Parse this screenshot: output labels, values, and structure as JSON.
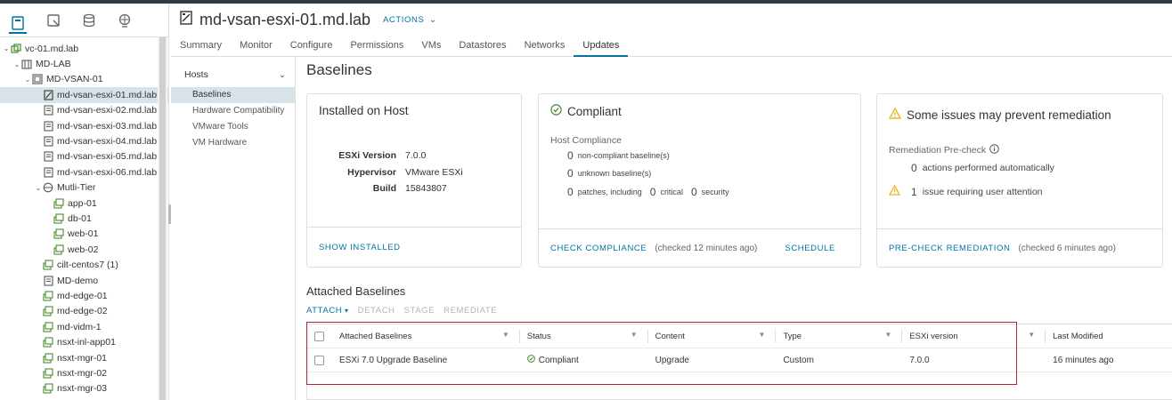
{
  "navigator": {
    "tree": [
      {
        "label": "vc-01.md.lab",
        "indent": 0,
        "chevron": "v",
        "icon": "vcenter"
      },
      {
        "label": "MD-LAB",
        "indent": 1,
        "chevron": "v",
        "icon": "datacenter"
      },
      {
        "label": "MD-VSAN-01",
        "indent": 2,
        "chevron": "v",
        "icon": "cluster"
      },
      {
        "label": "md-vsan-esxi-01.md.lab ...",
        "indent": 3,
        "chevron": "",
        "icon": "host-maint",
        "selected": true
      },
      {
        "label": "md-vsan-esxi-02.md.lab",
        "indent": 3,
        "chevron": "",
        "icon": "host"
      },
      {
        "label": "md-vsan-esxi-03.md.lab",
        "indent": 3,
        "chevron": "",
        "icon": "host"
      },
      {
        "label": "md-vsan-esxi-04.md.lab",
        "indent": 3,
        "chevron": "",
        "icon": "host"
      },
      {
        "label": "md-vsan-esxi-05.md.lab",
        "indent": 3,
        "chevron": "",
        "icon": "host"
      },
      {
        "label": "md-vsan-esxi-06.md.lab",
        "indent": 3,
        "chevron": "",
        "icon": "host"
      },
      {
        "label": "Mutli-Tier",
        "indent": 3,
        "chevron": "v",
        "icon": "vapp"
      },
      {
        "label": "app-01",
        "indent": 4,
        "chevron": "",
        "icon": "vm"
      },
      {
        "label": "db-01",
        "indent": 4,
        "chevron": "",
        "icon": "vm"
      },
      {
        "label": "web-01",
        "indent": 4,
        "chevron": "",
        "icon": "vm"
      },
      {
        "label": "web-02",
        "indent": 4,
        "chevron": "",
        "icon": "vm"
      },
      {
        "label": "cilt-centos7 (1)",
        "indent": 3,
        "chevron": "",
        "icon": "vm"
      },
      {
        "label": "MD-demo",
        "indent": 3,
        "chevron": "",
        "icon": "host"
      },
      {
        "label": "md-edge-01",
        "indent": 3,
        "chevron": "",
        "icon": "vm"
      },
      {
        "label": "md-edge-02",
        "indent": 3,
        "chevron": "",
        "icon": "vm"
      },
      {
        "label": "md-vidm-1",
        "indent": 3,
        "chevron": "",
        "icon": "vm"
      },
      {
        "label": "nsxt-inl-app01",
        "indent": 3,
        "chevron": "",
        "icon": "vm"
      },
      {
        "label": "nsxt-mgr-01",
        "indent": 3,
        "chevron": "",
        "icon": "vm"
      },
      {
        "label": "nsxt-mgr-02",
        "indent": 3,
        "chevron": "",
        "icon": "vm"
      },
      {
        "label": "nsxt-mgr-03",
        "indent": 3,
        "chevron": "",
        "icon": "vm"
      }
    ]
  },
  "header": {
    "title": "md-vsan-esxi-01.md.lab",
    "actions_label": "ACTIONS",
    "tabs": [
      "Summary",
      "Monitor",
      "Configure",
      "Permissions",
      "VMs",
      "Datastores",
      "Networks",
      "Updates"
    ],
    "active_tab": "Updates"
  },
  "subnav": {
    "group": "Hosts",
    "items": [
      "Baselines",
      "Hardware Compatibility",
      "VMware Tools",
      "VM Hardware"
    ]
  },
  "main": {
    "title": "Baselines",
    "installed": {
      "title": "Installed on Host",
      "rows": [
        {
          "k": "ESXi Version",
          "v": "7.0.0"
        },
        {
          "k": "Hypervisor",
          "v": "VMware ESXi"
        },
        {
          "k": "Build",
          "v": "15843807"
        }
      ],
      "action": "SHOW INSTALLED"
    },
    "compliant": {
      "title": "Compliant",
      "subtitle": "Host Compliance",
      "line1_num": "0",
      "line1_text": "non-compliant baseline(s)",
      "line2_num": "0",
      "line2_text": "unknown baseline(s)",
      "line3_num1": "0",
      "line3_text1": "patches, including",
      "line3_num2": "0",
      "line3_text2": "critical",
      "line3_num3": "0",
      "line3_text3": "security",
      "action": "CHECK COMPLIANCE",
      "checked": "(checked 12 minutes ago)",
      "schedule": "SCHEDULE"
    },
    "remediation": {
      "title": "Some issues may prevent remediation",
      "subtitle": "Remediation Pre-check",
      "line1_num": "0",
      "line1_text": "actions performed automatically",
      "line2_num": "1",
      "line2_text": "issue requiring user attention",
      "action": "PRE-CHECK REMEDIATION",
      "checked": "(checked 6 minutes ago)"
    },
    "attached": {
      "title": "Attached Baselines",
      "toolbar": {
        "attach": "ATTACH",
        "detach": "DETACH",
        "stage": "STAGE",
        "remediate": "REMEDIATE"
      },
      "columns": [
        "Attached Baselines",
        "Status",
        "Content",
        "Type",
        "ESXi version",
        "Last Modified"
      ],
      "rows": [
        {
          "name": "ESXi 7.0 Upgrade Baseline",
          "status": "Compliant",
          "content": "Upgrade",
          "type": "Custom",
          "version": "7.0.0",
          "modified": "16 minutes ago"
        }
      ]
    }
  },
  "colors": {
    "accent": "#0072a3",
    "highlight": "#b0272f",
    "compliant": "#4a8b2c",
    "warning": "#e8b00b"
  }
}
